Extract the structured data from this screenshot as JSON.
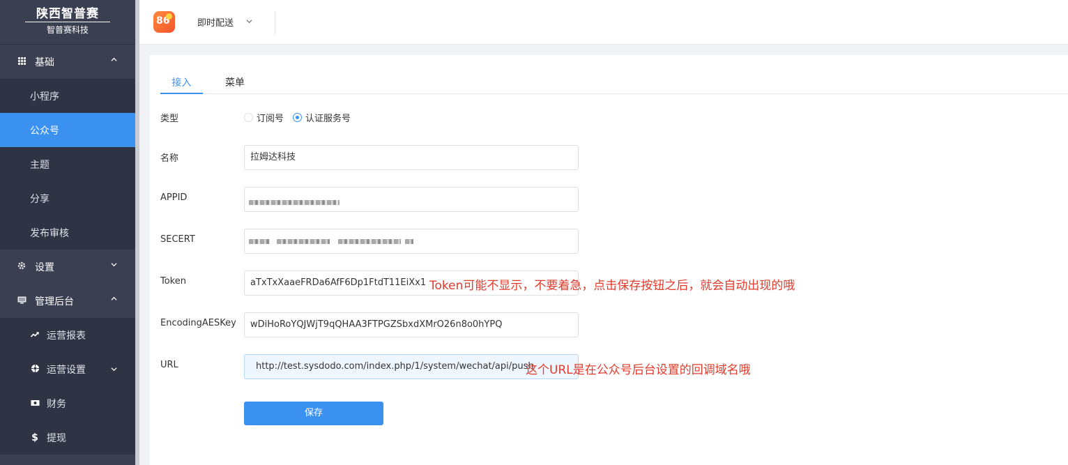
{
  "brand": {
    "title": "陕西智普赛",
    "subtitle": "智普赛科技"
  },
  "sidebar": {
    "groups": [
      {
        "label": "基础",
        "icon": "grid-icon",
        "expanded": true,
        "items": [
          "小程序",
          "公众号",
          "主题",
          "分享",
          "发布审核"
        ]
      },
      {
        "label": "设置",
        "icon": "gear-icon",
        "expanded": false
      },
      {
        "label": "管理后台",
        "icon": "monitor-icon",
        "expanded": true,
        "items": [
          {
            "label": "运营报表",
            "icon": "trend-icon"
          },
          {
            "label": "运营设置",
            "icon": "cog-wheel-icon"
          },
          {
            "label": "财务",
            "icon": "money-icon"
          },
          {
            "label": "提现",
            "icon": "dollar-icon"
          }
        ]
      }
    ],
    "active_item": "公众号"
  },
  "topbar": {
    "app_name": "即时配送",
    "logo_text": "86"
  },
  "tabs": [
    "接入",
    "菜单"
  ],
  "active_tab": "接入",
  "form": {
    "type_label": "类型",
    "type_options": [
      "订阅号",
      "认证服务号"
    ],
    "type_selected": "认证服务号",
    "name_label": "名称",
    "name_value": "拉姆达科技",
    "appid_label": "APPID",
    "secret_label": "SECERT",
    "token_label": "Token",
    "token_value": "aTxTxXaaeFRDa6AfF6Dp1FtdT11EiXx1",
    "aeskey_label": "EncodingAESKey",
    "aeskey_value": "wDiHoRoYQJWjT9qQHAA3FTPGZSbxdXMrO26n8o0hYPQ",
    "url_label": "URL",
    "url_value": "http://test.sysdodo.com/index.php/1/system/wechat/api/push",
    "save_label": "保存"
  },
  "notes": {
    "token_note": "Token可能不显示，不要着急，点击保存按钮之后，就会自动出现的哦",
    "url_note": "这个URL是在公众号后台设置的回调域名哦"
  },
  "colors": {
    "accent": "#3b91f0",
    "sidebar": "#3a3f51",
    "note": "#e23b2c"
  }
}
